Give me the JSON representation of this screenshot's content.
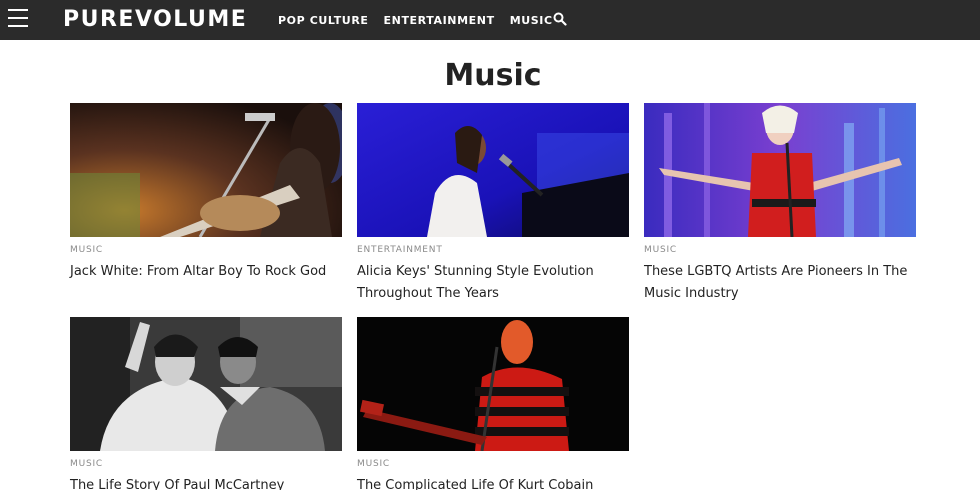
{
  "header": {
    "logo": "PUREVOLUME",
    "nav": [
      "POP CULTURE",
      "ENTERTAINMENT",
      "MUSIC"
    ],
    "menu_icon": "hamburger-menu-icon",
    "search_icon": "search-icon"
  },
  "page": {
    "title": "Music"
  },
  "articles": [
    {
      "category": "MUSIC",
      "title": "Jack White: From Altar Boy To Rock God"
    },
    {
      "category": "ENTERTAINMENT",
      "title": "Alicia Keys' Stunning Style Evolution Throughout The Years"
    },
    {
      "category": "MUSIC",
      "title": "These LGBTQ Artists Are Pioneers In The Music Industry"
    },
    {
      "category": "MUSIC",
      "title": "The Life Story Of Paul McCartney"
    },
    {
      "category": "MUSIC",
      "title": "The Complicated Life Of Kurt Cobain"
    }
  ],
  "colors": {
    "header_bg": "#2b2b2b",
    "category": "#8a8a8a"
  }
}
